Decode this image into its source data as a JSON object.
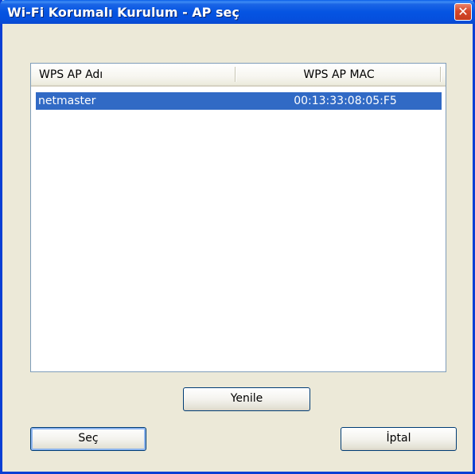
{
  "window": {
    "title": "Wi-Fi Korumalı Kurulum - AP seç",
    "close_label": "✕"
  },
  "list": {
    "columns": [
      "WPS AP Adı",
      "WPS AP MAC"
    ],
    "rows": [
      {
        "name": "netmaster",
        "mac": "00:13:33:08:05:F5",
        "selected": true
      }
    ]
  },
  "buttons": {
    "refresh": "Yenile",
    "select": "Seç",
    "cancel": "İptal"
  },
  "colors": {
    "titlebar": "#0554e2",
    "selection": "#316ac5",
    "close_button": "#d5482a",
    "window_face": "#ece9d8"
  }
}
